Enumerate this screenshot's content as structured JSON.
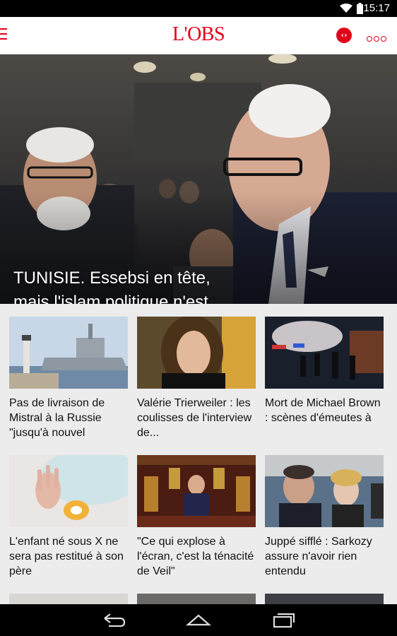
{
  "status": {
    "time": "15:17"
  },
  "app": {
    "logo": "L'OBS"
  },
  "hero": {
    "title": "TUNISIE. Essebsi en tête, mais l'islam politique n'est pas fini"
  },
  "articles": [
    {
      "title": "Pas de livraison de Mistral à la Russie \"jusqu'à nouvel"
    },
    {
      "title": "Valérie Trierweiler : les coulisses de l'interview de..."
    },
    {
      "title": "Mort de Michael Brown : scènes d'émeutes à"
    },
    {
      "title": "L'enfant né sous X ne sera pas restitué à son père"
    },
    {
      "title": "\"Ce qui explose à l'écran, c'est la ténacité de Veil\""
    },
    {
      "title": "Juppé sifflé : Sarkozy assure n'avoir rien entendu"
    }
  ],
  "colors": {
    "brand": "#e2001a"
  }
}
